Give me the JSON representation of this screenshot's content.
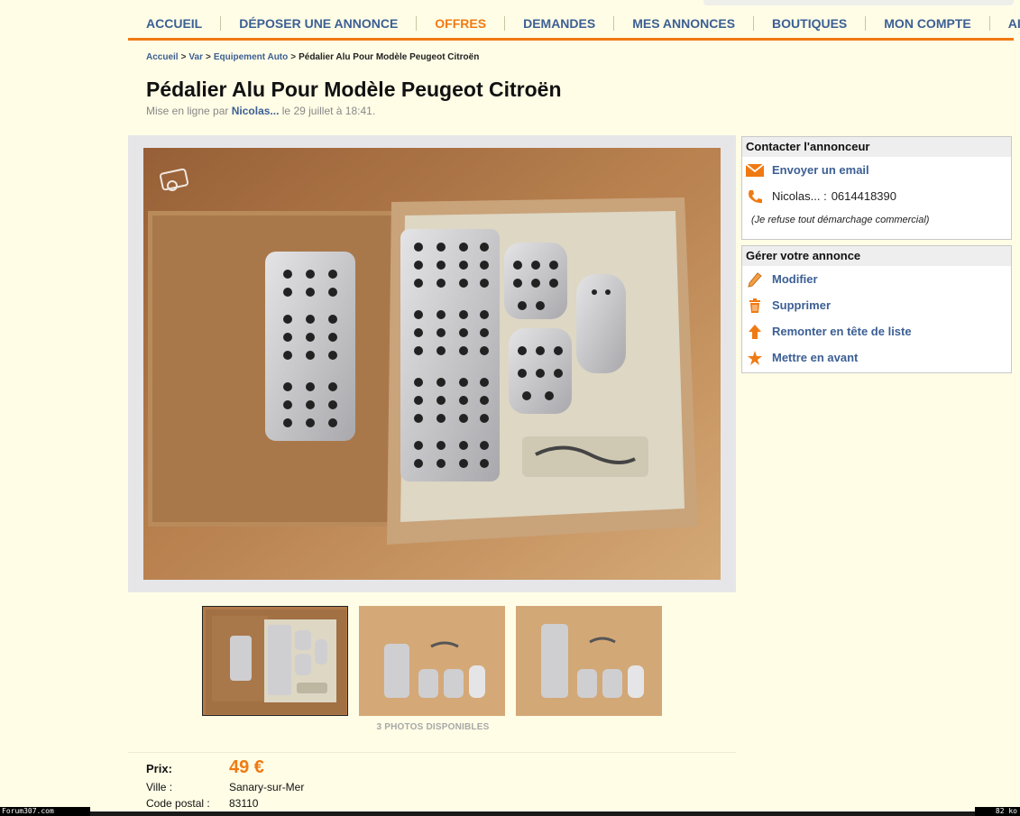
{
  "nav": {
    "items": [
      {
        "label": "ACCUEIL"
      },
      {
        "label": "DÉPOSER UNE ANNONCE"
      },
      {
        "label": "OFFRES",
        "active": true
      },
      {
        "label": "DEMANDES"
      },
      {
        "label": "MES ANNONCES"
      },
      {
        "label": "BOUTIQUES"
      },
      {
        "label": "MON COMPTE"
      },
      {
        "label": "AIDE"
      }
    ]
  },
  "breadcrumb": {
    "home": "Accueil",
    "region": "Var",
    "category": "Equipement Auto",
    "current": "Pédalier Alu Pour Modèle Peugeot Citroën",
    "separator": ">"
  },
  "ad": {
    "title": "Pédalier Alu Pour Modèle Peugeot Citroën",
    "posted_prefix": "Mise en ligne par",
    "author": "Nicolas...",
    "posted_suffix": "le 29 juillet à 18:41."
  },
  "contact": {
    "heading": "Contacter l'annonceur",
    "email_label": "Envoyer un email",
    "phone_name": "Nicolas... :",
    "phone": "0614418390",
    "refuse": "(Je refuse tout démarchage commercial)"
  },
  "manage": {
    "heading": "Gérer votre annonce",
    "modify": "Modifier",
    "delete": "Supprimer",
    "bump": "Remonter en tête de liste",
    "feature": "Mettre en avant"
  },
  "photos": {
    "count_label": "3 PHOTOS DISPONIBLES"
  },
  "details": {
    "price_label": "Prix:",
    "price": "49 €",
    "city_label": "Ville :",
    "city": "Sanary-sur-Mer",
    "zip_label": "Code postal :",
    "zip": "83110"
  },
  "footer": {
    "left": "Forum307.com",
    "right": "82 ko"
  },
  "colors": {
    "accent": "#f07a12",
    "link": "#3c5f94",
    "background": "#fffde6"
  },
  "icons": [
    "camera-icon",
    "envelope-icon",
    "phone-icon",
    "pencil-icon",
    "trash-icon",
    "arrow-up-icon",
    "star-icon"
  ]
}
